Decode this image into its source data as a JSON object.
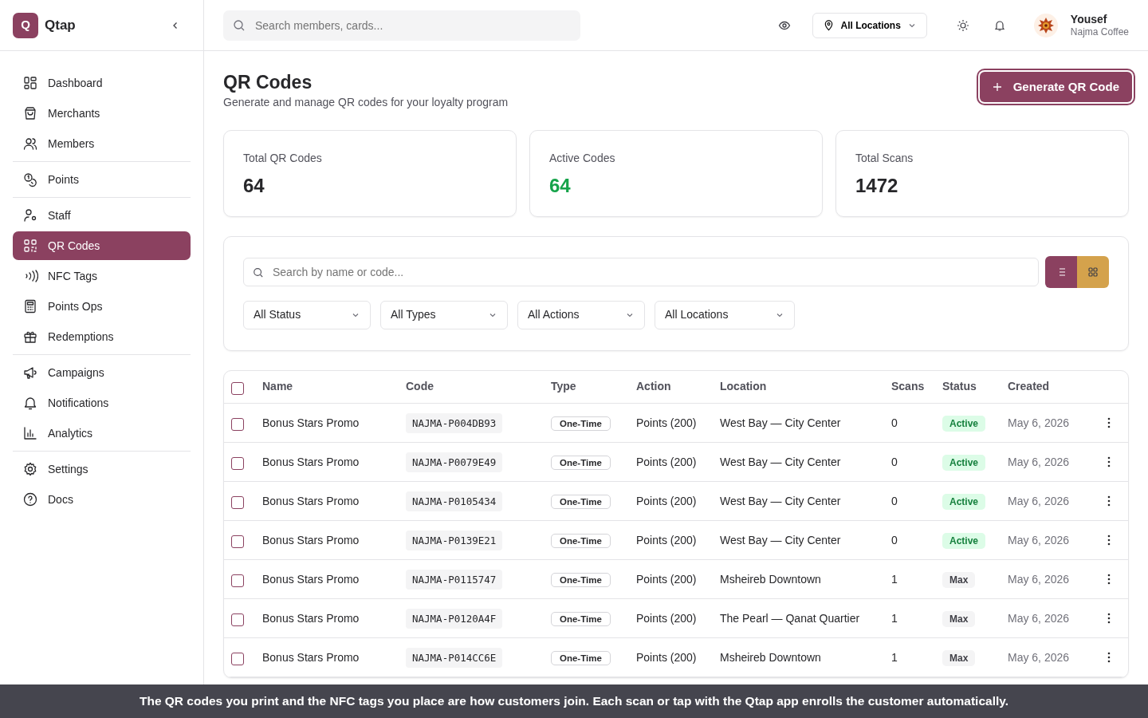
{
  "brand": {
    "logo_letter": "Q",
    "name": "Qtap"
  },
  "nav_groups": [
    [
      {
        "label": "Dashboard",
        "selected": false
      },
      {
        "label": "Merchants",
        "selected": false
      },
      {
        "label": "Members",
        "selected": false
      }
    ],
    [
      {
        "label": "Points",
        "selected": false
      }
    ],
    [
      {
        "label": "Staff",
        "selected": false
      },
      {
        "label": "QR Codes",
        "selected": true
      },
      {
        "label": "NFC Tags",
        "selected": false
      },
      {
        "label": "Points Ops",
        "selected": false
      },
      {
        "label": "Redemptions",
        "selected": false
      }
    ],
    [
      {
        "label": "Campaigns",
        "selected": false
      },
      {
        "label": "Notifications",
        "selected": false
      },
      {
        "label": "Analytics",
        "selected": false
      }
    ],
    [
      {
        "label": "Settings",
        "selected": false
      },
      {
        "label": "Docs",
        "selected": false
      }
    ]
  ],
  "topbar": {
    "search": {
      "placeholder": "Search members, cards..."
    },
    "location": "All Locations",
    "user": {
      "name": "Yousef",
      "org": "Najma Coffee"
    }
  },
  "page": {
    "title": "QR Codes",
    "subtitle": "Generate and manage QR codes for your loyalty program",
    "action": "Generate QR Code"
  },
  "stats": [
    {
      "label": "Total QR Codes",
      "value": "64",
      "color": "#27272a"
    },
    {
      "label": "Active Codes",
      "value": "64",
      "color": "#16a34a"
    },
    {
      "label": "Total Scans",
      "value": "1472",
      "color": "#27272a"
    }
  ],
  "filters": {
    "search": {
      "placeholder": "Search by name or code..."
    },
    "view_toggle": [
      {
        "kind": "list",
        "selected": true
      },
      {
        "kind": "grid",
        "selected": false
      }
    ],
    "selects": [
      "All Status",
      "All Types",
      "All Actions",
      "All Locations"
    ]
  },
  "table": {
    "select_all": {
      "checked": false
    },
    "columns": [
      "Name",
      "Code",
      "Type",
      "Action",
      "Location",
      "Scans",
      "Status",
      "Created"
    ],
    "rows": [
      {
        "checked": false,
        "name": "Bonus Stars Promo",
        "code": "NAJMA-P004DB93",
        "type": "One-Time",
        "action": "Points (200)",
        "location": "West Bay — City Center",
        "scans": "0",
        "status": {
          "label": "Active",
          "kind": "active"
        },
        "created": "May 6, 2026"
      },
      {
        "checked": false,
        "name": "Bonus Stars Promo",
        "code": "NAJMA-P0079E49",
        "type": "One-Time",
        "action": "Points (200)",
        "location": "West Bay — City Center",
        "scans": "0",
        "status": {
          "label": "Active",
          "kind": "active"
        },
        "created": "May 6, 2026"
      },
      {
        "checked": false,
        "name": "Bonus Stars Promo",
        "code": "NAJMA-P0105434",
        "type": "One-Time",
        "action": "Points (200)",
        "location": "West Bay — City Center",
        "scans": "0",
        "status": {
          "label": "Active",
          "kind": "active"
        },
        "created": "May 6, 2026"
      },
      {
        "checked": false,
        "name": "Bonus Stars Promo",
        "code": "NAJMA-P0139E21",
        "type": "One-Time",
        "action": "Points (200)",
        "location": "West Bay — City Center",
        "scans": "0",
        "status": {
          "label": "Active",
          "kind": "active"
        },
        "created": "May 6, 2026"
      },
      {
        "checked": false,
        "name": "Bonus Stars Promo",
        "code": "NAJMA-P0115747",
        "type": "One-Time",
        "action": "Points (200)",
        "location": "Msheireb Downtown",
        "scans": "1",
        "status": {
          "label": "Max",
          "kind": "max"
        },
        "created": "May 6, 2026"
      },
      {
        "checked": false,
        "name": "Bonus Stars Promo",
        "code": "NAJMA-P0120A4F",
        "type": "One-Time",
        "action": "Points (200)",
        "location": "The Pearl — Qanat Quartier",
        "scans": "1",
        "status": {
          "label": "Max",
          "kind": "max"
        },
        "created": "May 6, 2026"
      },
      {
        "checked": false,
        "name": "Bonus Stars Promo",
        "code": "NAJMA-P014CC6E",
        "type": "One-Time",
        "action": "Points (200)",
        "location": "Msheireb Downtown",
        "scans": "1",
        "status": {
          "label": "Max",
          "kind": "max"
        },
        "created": "May 6, 2026"
      }
    ]
  },
  "caption": "The QR codes you print and the NFC tags you place are how customers join. Each scan or tap with the Qtap app enrolls the customer automatically."
}
